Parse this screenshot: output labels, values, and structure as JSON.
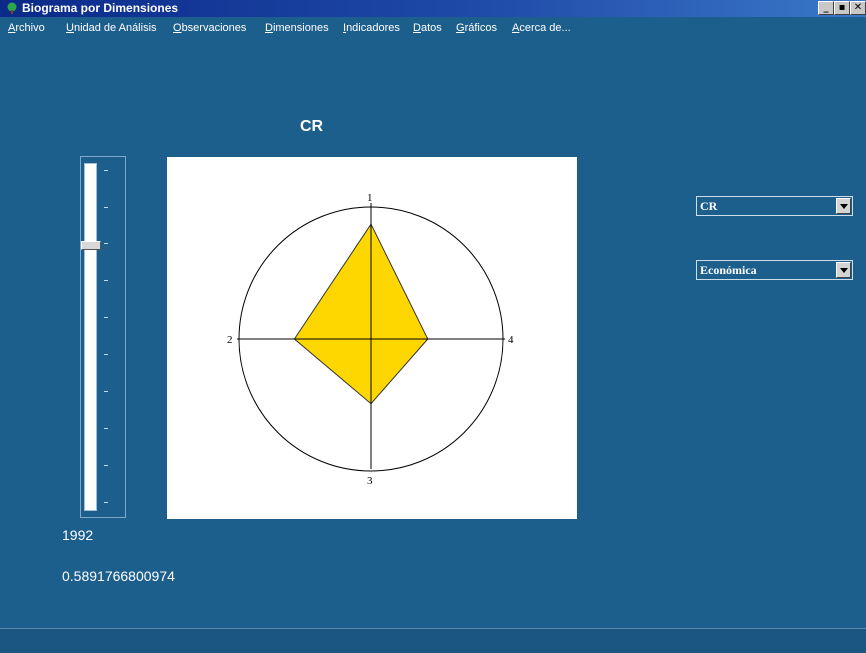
{
  "window": {
    "title": "Biograma por Dimensiones",
    "minimize_label": "_",
    "maximize_label": "▪",
    "close_label": "✕"
  },
  "menu": {
    "items": [
      {
        "label": "Archivo"
      },
      {
        "label": "Unidad de Análisis"
      },
      {
        "label": "Observaciones"
      },
      {
        "label": "Dimensiones"
      },
      {
        "label": "Indicadores"
      },
      {
        "label": "Datos"
      },
      {
        "label": "Gráficos"
      },
      {
        "label": "Acerca de..."
      }
    ]
  },
  "main": {
    "chart_title": "CR",
    "year": "1992",
    "value": "0.5891766800974",
    "slider_level": 0.23,
    "country_select": {
      "value": "CR"
    },
    "dimension_select": {
      "value": "Económica"
    }
  },
  "colors": {
    "background": "#1d5f8c",
    "polygon_fill": "#ffd700",
    "titlebar": "#0b2a8a"
  },
  "chart_data": {
    "type": "radar",
    "title": "CR",
    "axes": [
      "1",
      "2",
      "3",
      "4"
    ],
    "values": [
      0.87,
      0.58,
      0.49,
      0.43
    ],
    "range": [
      0,
      1
    ],
    "fill_color": "#ffd700"
  }
}
